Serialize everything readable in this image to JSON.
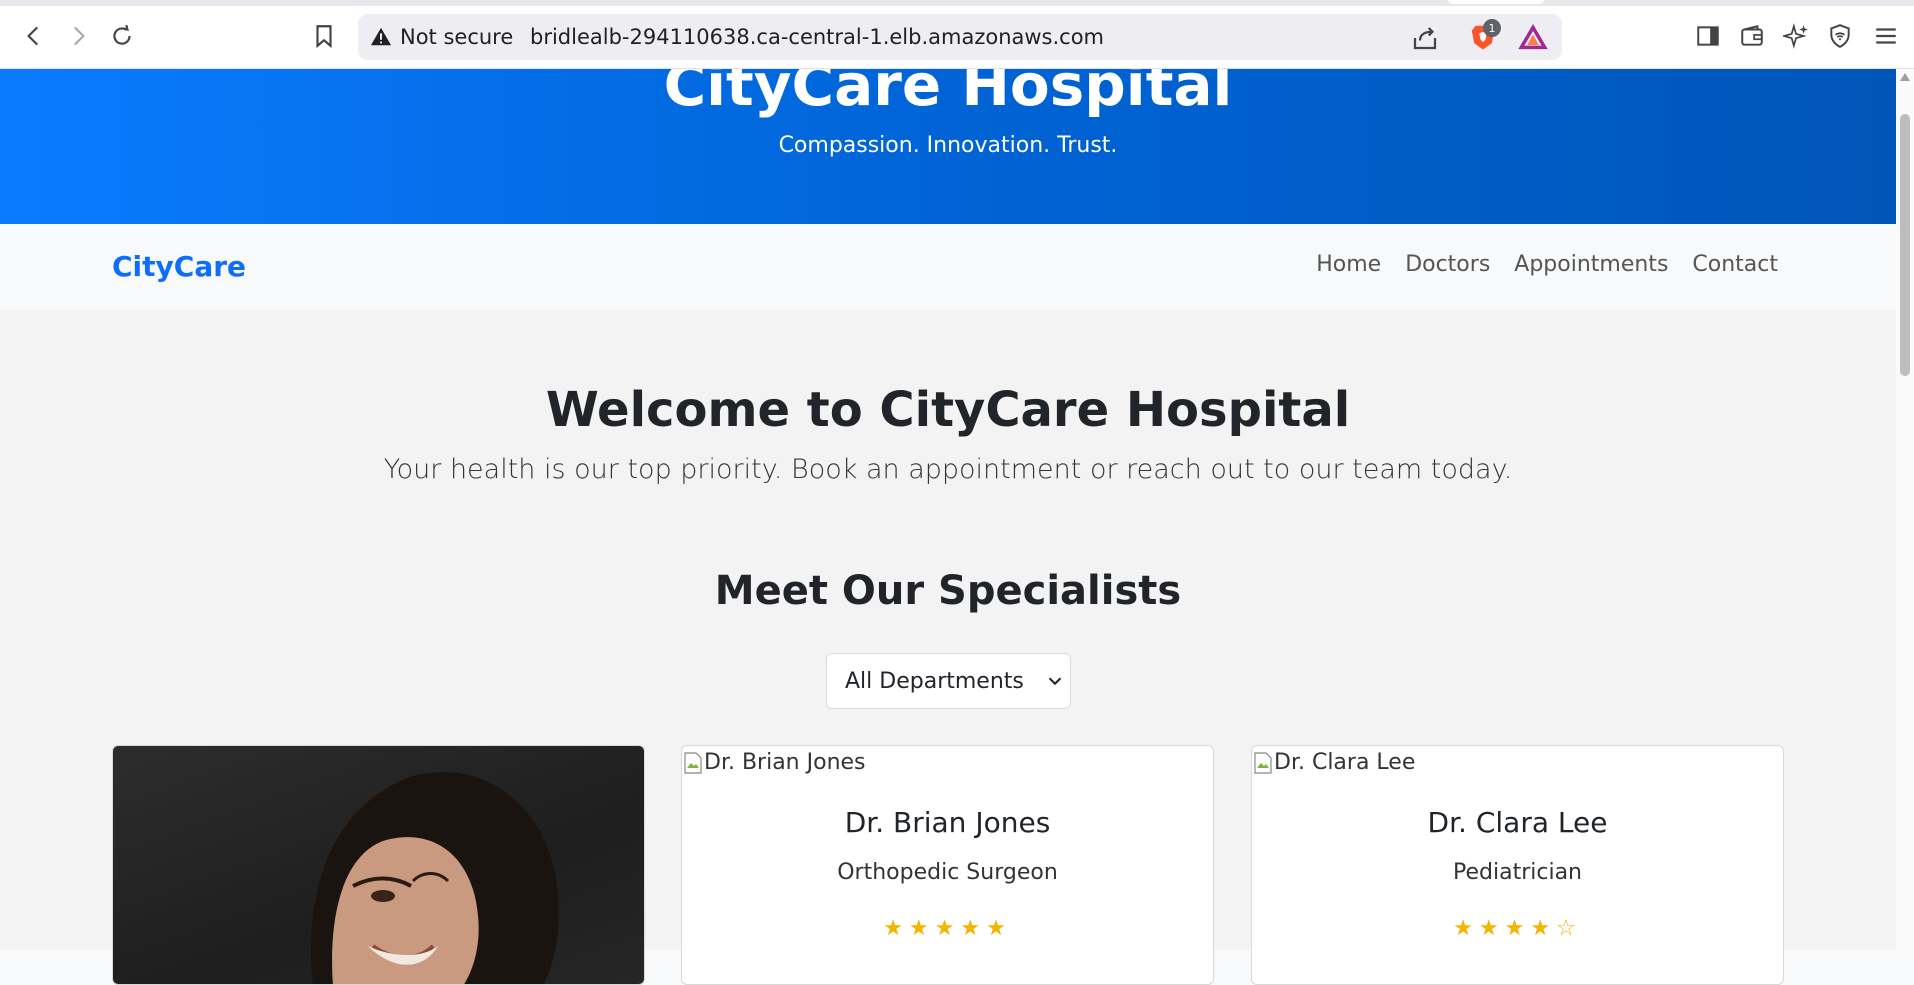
{
  "browser": {
    "security_label": "Not secure",
    "url": "bridlealb-294110638.ca-central-1.elb.amazonaws.com",
    "brave_badge_count": "1"
  },
  "hero": {
    "title": "CityCare Hospital",
    "tagline": "Compassion. Innovation. Trust."
  },
  "navbar": {
    "brand": "CityCare",
    "links": [
      "Home",
      "Doctors",
      "Appointments",
      "Contact"
    ]
  },
  "main": {
    "welcome": "Welcome to CityCare Hospital",
    "lead": "Your health is our top priority. Book an appointment or reach out to our team today.",
    "specialists_heading": "Meet Our Specialists",
    "department_filter": "All Departments"
  },
  "doctors": [
    {
      "name": "",
      "specialty": "",
      "image_alt": "",
      "rating": null
    },
    {
      "name": "Dr. Brian Jones",
      "specialty": "Orthopedic Surgeon",
      "image_alt": "Dr. Brian Jones",
      "rating_stars": "★★★★★",
      "rating": 5
    },
    {
      "name": "Dr. Clara Lee",
      "specialty": "Pediatrician",
      "image_alt": "Dr. Clara Lee",
      "rating_stars": "★★★★☆",
      "rating": 4
    }
  ],
  "colors": {
    "brand_blue": "#0d6efd",
    "hero_start": "#0a7bff",
    "hero_end": "#0055b8",
    "star": "#f4b400"
  }
}
